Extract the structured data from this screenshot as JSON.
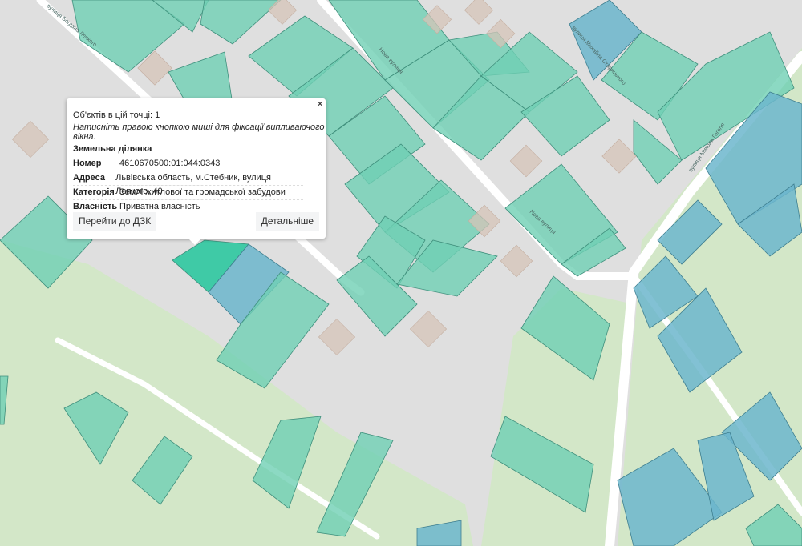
{
  "popup": {
    "count_text": "Об'єктів в цій точці: 1",
    "hint": "Натисніть правою кнопкою миші для фіксації випливаючого вікна.",
    "close": "×",
    "title": "Земельна ділянка",
    "rows": [
      {
        "key": "Номер",
        "value": "4610670500:01:044:0343"
      },
      {
        "key": "Адреса",
        "value": "Львівська область, м.Стебник, вулиця Лепкого, 40"
      },
      {
        "key": "Категорія",
        "value": "Землі житлової та громадської забудови"
      },
      {
        "key": "Власність",
        "value": "Приватна власність"
      }
    ],
    "btn_dzk": "Перейти до ДЗК",
    "btn_more": "Детальніше"
  },
  "streets": {
    "lepkoho": "вулиця Богдана Лепкого",
    "nova1": "Нова вулиця",
    "nova2": "Нова вулиця",
    "starytskoho": "вулиця Михайла Старицького",
    "hoholia": "вулиця Миколи Гоголя"
  },
  "colors": {
    "parcel": "#6fd0b4",
    "parcel_blue": "#6cb6cc",
    "selected": "#3fcaa6",
    "green_area": "#d3e7c8"
  }
}
